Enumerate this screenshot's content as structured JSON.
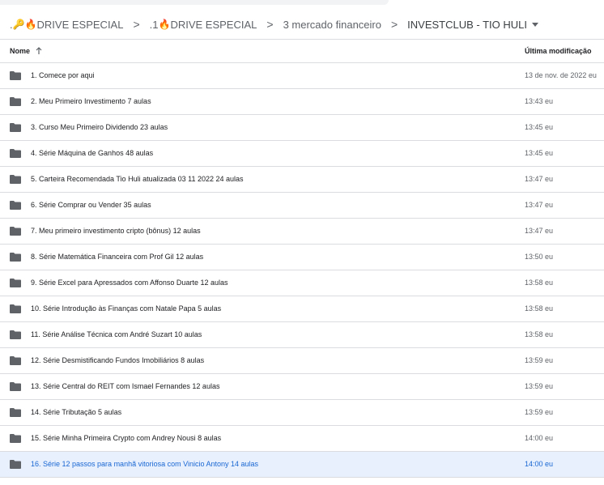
{
  "breadcrumb": [
    {
      "prefix_text": ".",
      "label": "DRIVE ESPECIAL"
    },
    {
      "prefix_text": ".1",
      "label": "DRIVE ESPECIAL"
    },
    {
      "label": "3 mercado financeiro"
    },
    {
      "label": "INVESTCLUB - TIO HULI"
    }
  ],
  "icons": {
    "key": "🔑",
    "fire": "🔥"
  },
  "separator": ">",
  "columns": {
    "name": "Nome",
    "modified": "Última modificação"
  },
  "rows": [
    {
      "name": "1. Comece por aqui",
      "modified": "13 de nov. de 2022 eu"
    },
    {
      "name": "2. Meu Primeiro Investimento 7 aulas",
      "modified": "13:43 eu"
    },
    {
      "name": "3. Curso Meu Primeiro Dividendo 23 aulas",
      "modified": "13:45 eu"
    },
    {
      "name": "4. Série Máquina de Ganhos 48 aulas",
      "modified": "13:45 eu"
    },
    {
      "name": "5. Carteira Recomendada Tio Huli atualizada 03 11 2022 24 aulas",
      "modified": "13:47 eu"
    },
    {
      "name": "6. Série Comprar ou Vender 35 aulas",
      "modified": "13:47 eu"
    },
    {
      "name": "7. Meu primeiro investimento cripto (bônus) 12 aulas",
      "modified": "13:47 eu"
    },
    {
      "name": "8. Série Matemática Financeira com Prof Gil 12 aulas",
      "modified": "13:50 eu"
    },
    {
      "name": "9. Série Excel para Apressados com Affonso Duarte 12 aulas",
      "modified": "13:58 eu"
    },
    {
      "name": "10. Série Introdução às Finanças com Natale Papa 5 aulas",
      "modified": "13:58 eu"
    },
    {
      "name": "11. Série Análise Técnica com André Suzart 10 aulas",
      "modified": "13:58 eu"
    },
    {
      "name": "12. Série Desmistificando Fundos Imobiliários 8 aulas",
      "modified": "13:59 eu"
    },
    {
      "name": "13. Série Central do REIT com Ismael Fernandes 12 aulas",
      "modified": "13:59 eu"
    },
    {
      "name": "14. Série Tributação 5 aulas",
      "modified": "13:59 eu"
    },
    {
      "name": "15. Série Minha Primeira Crypto com Andrey Nousi 8 aulas",
      "modified": "14:00 eu"
    },
    {
      "name": "16. Série 12 passos para manhã vitoriosa com Vinicio Antony 14 aulas",
      "modified": "14:00 eu",
      "selected": true
    }
  ]
}
